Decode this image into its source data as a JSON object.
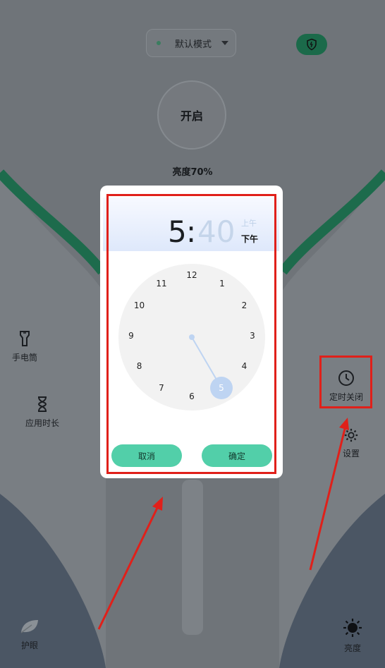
{
  "top_bar": {
    "mode_label": "默认模式",
    "shield_icon": "shield-icon"
  },
  "power": {
    "label": "开启"
  },
  "brightness": {
    "label": "亮度70%"
  },
  "left_menu": [
    {
      "label": "手电筒",
      "icon": "flashlight-icon"
    },
    {
      "label": "应用时长",
      "icon": "hourglass-icon"
    }
  ],
  "right_menu": [
    {
      "label": "定时关闭",
      "icon": "clock-icon"
    },
    {
      "label": "设置",
      "icon": "gear-icon"
    }
  ],
  "bottom": {
    "eye_care": {
      "label": "护眼",
      "icon": "leaf-icon"
    },
    "brightness_btn": {
      "label": "亮度",
      "icon": "sun-icon"
    }
  },
  "time_picker": {
    "hour": "5",
    "separator": ":",
    "minute": "40",
    "am": "上午",
    "pm": "下午",
    "selected_period": "下午",
    "dial_numbers": [
      "12",
      "1",
      "2",
      "3",
      "4",
      "5",
      "6",
      "7",
      "8",
      "9",
      "10",
      "11"
    ],
    "selected_value": "5",
    "cancel_label": "取消",
    "confirm_label": "确定"
  },
  "colors": {
    "accent": "#52cfa9",
    "dial_highlight": "#bed4f2",
    "annotation": "#e0201a"
  }
}
